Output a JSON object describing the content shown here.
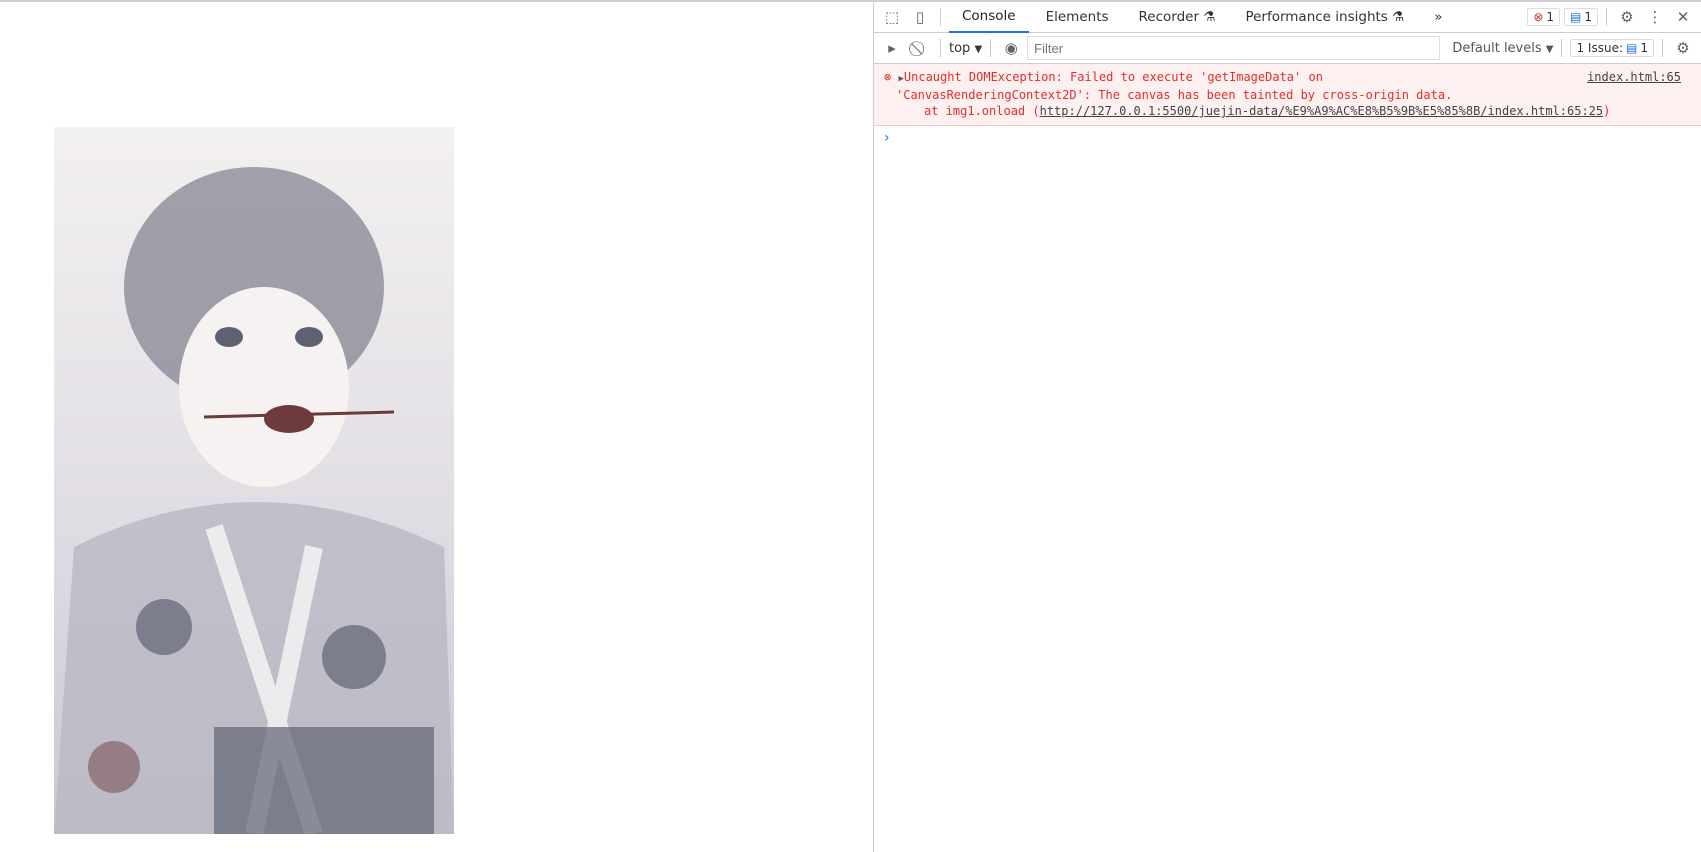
{
  "devtools": {
    "tabs": [
      "Console",
      "Elements",
      "Recorder",
      "Performance insights"
    ],
    "active_tab": "Console",
    "more_tabs": "»",
    "error_count": "1",
    "message_count": "1",
    "context": "top",
    "filter_placeholder": "Filter",
    "levels": "Default levels",
    "issues_label": "1 Issue:",
    "issues_count": "1",
    "error": {
      "line1": "Uncaught DOMException: Failed to execute 'getImageData' on",
      "line2": "'CanvasRenderingContext2D': The canvas has been tainted by cross-origin data.",
      "at_prefix": "at img1.onload (",
      "link": "http://127.0.0.1:5500/juejin-data/%E9%A9%AC%E8%B5%9B%E5%85%8B/index.html:65:25",
      "suffix": ")",
      "source": "index.html:65"
    },
    "prompt": "›"
  },
  "colors": {
    "error": "#e0302a",
    "accent": "#1a73e8",
    "error_bg": "#fdf0f0"
  }
}
